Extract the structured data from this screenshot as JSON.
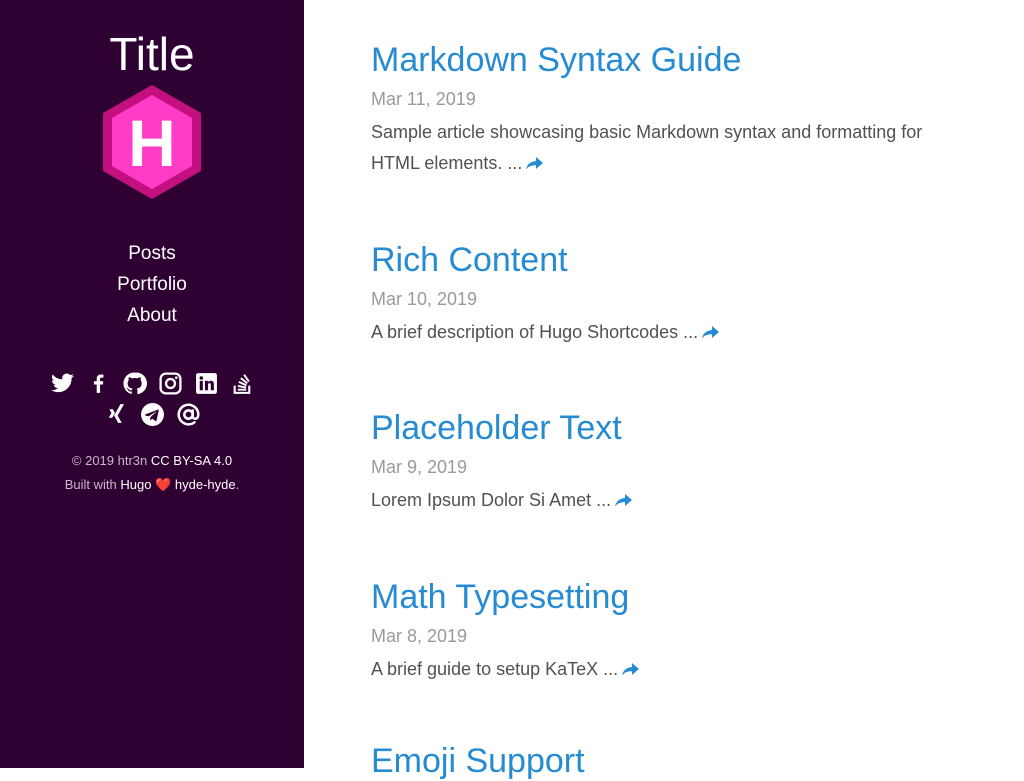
{
  "sidebar": {
    "title": "Title",
    "logo_letter": "H",
    "nav": [
      "Posts",
      "Portfolio",
      "About"
    ],
    "social_icons_row1": [
      "twitter-icon",
      "facebook-icon",
      "github-icon",
      "instagram-icon",
      "linkedin-icon",
      "stackoverflow-icon"
    ],
    "social_icons_row2": [
      "xing-icon",
      "telegram-icon",
      "email-icon"
    ],
    "footer": {
      "copyright": "© 2019 htr3n",
      "license": "CC BY-SA 4.0",
      "built_with": "Built with",
      "hugo": "Hugo",
      "heart": "❤️",
      "theme": "hyde-hyde",
      "period": "."
    }
  },
  "colors": {
    "sidebar_bg": "#2f0032",
    "link": "#268bd2",
    "logo_pink": "#ff3cc8"
  },
  "posts": [
    {
      "title": "Markdown Syntax Guide",
      "date": "Mar 11, 2019",
      "summary": "Sample article showcasing basic Markdown syntax and formatting for HTML elements. ..."
    },
    {
      "title": "Rich Content",
      "date": "Mar 10, 2019",
      "summary": "A brief description of Hugo Shortcodes ..."
    },
    {
      "title": "Placeholder Text",
      "date": "Mar 9, 2019",
      "summary": "Lorem Ipsum Dolor Si Amet ..."
    },
    {
      "title": "Math Typesetting",
      "date": "Mar 8, 2019",
      "summary": "A brief guide to setup KaTeX ..."
    },
    {
      "title": "Emoji Support",
      "date": "",
      "summary": ""
    }
  ]
}
